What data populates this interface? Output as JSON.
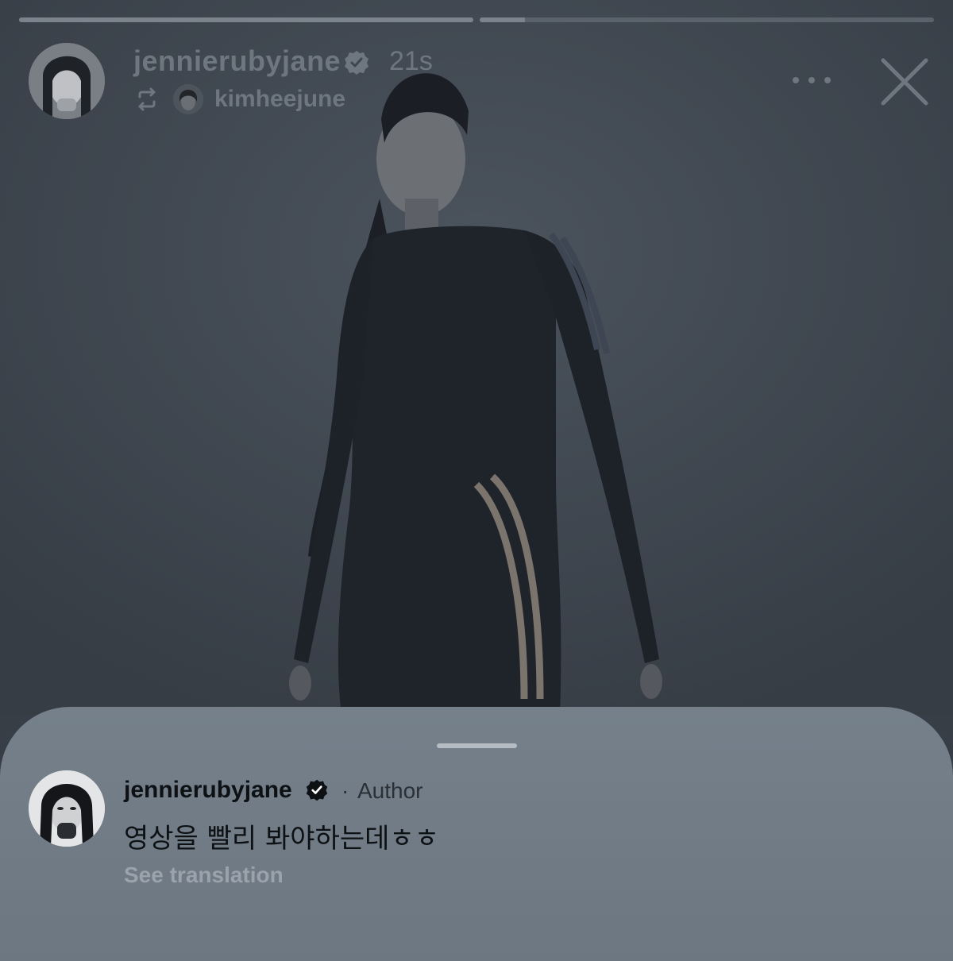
{
  "story": {
    "progress_fraction_current": 0.1,
    "header": {
      "username": "jennierubyjane",
      "time": "21s",
      "repost_username": "kimheejune"
    }
  },
  "comment": {
    "username": "jennierubyjane",
    "separator": "·",
    "badge": "Author",
    "text": "영상을 빨리 봐야하는데ㅎㅎ",
    "translate_label": "See translation"
  },
  "icons": {
    "verified": "verified-badge-icon",
    "repost": "repost-icon",
    "more": "more-options-icon",
    "close": "close-icon"
  },
  "colors": {
    "sheet": "#75808b",
    "header_text": "#6e767f",
    "comment_text": "#0d1114",
    "secondary_text": "#9aa3ac"
  }
}
